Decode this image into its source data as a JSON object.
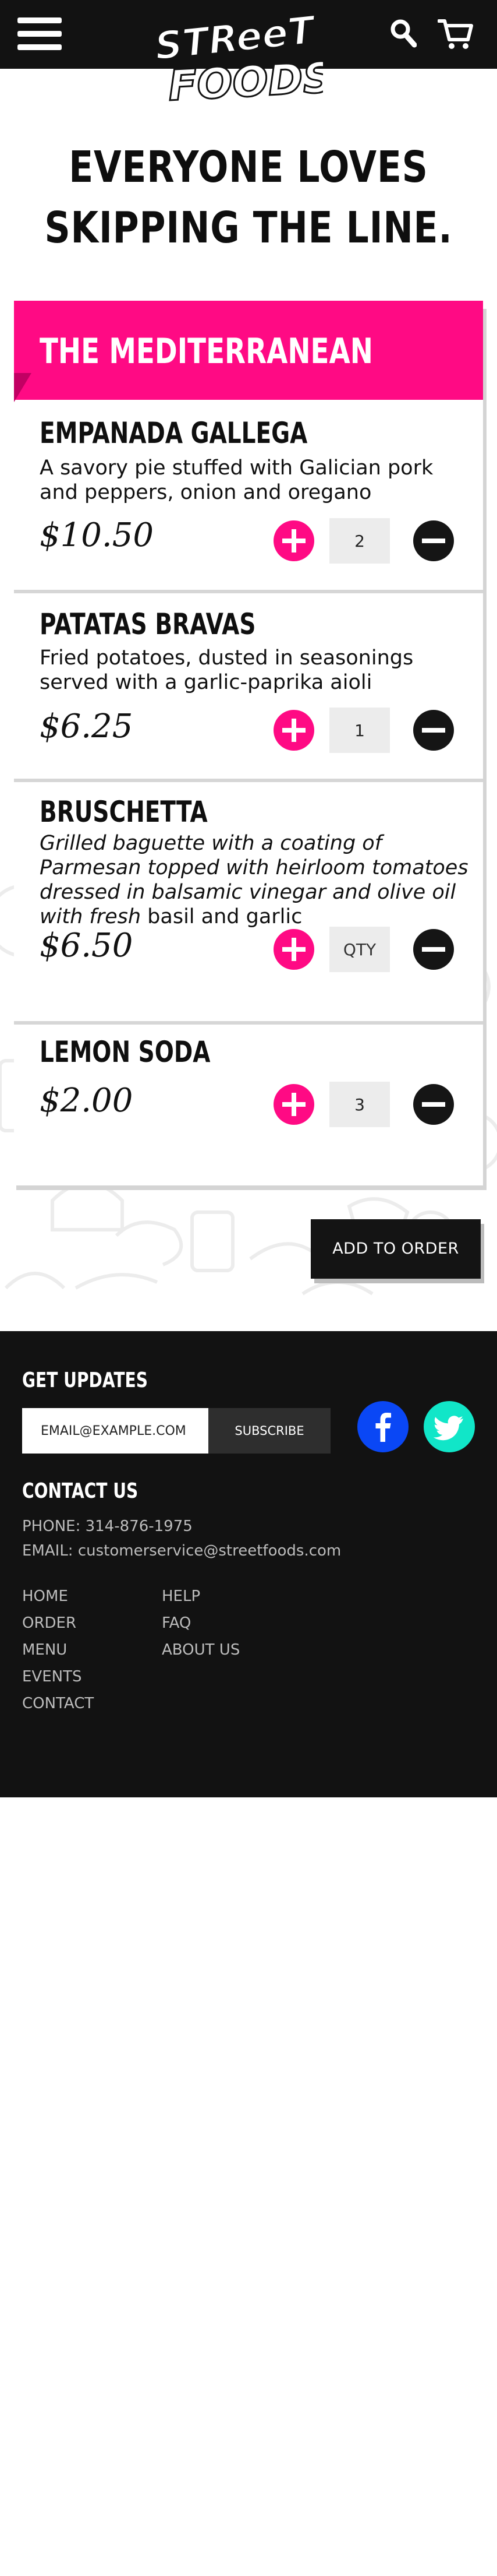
{
  "header": {
    "brand": "Street Foods",
    "hero_line1": "EVERYONE LOVES",
    "hero_line2": "SKIPPING THE LINE.",
    "icons": [
      "menu-icon",
      "search-icon",
      "cart-icon"
    ]
  },
  "menu": {
    "title": "THE MEDITERRANEAN",
    "items": [
      {
        "name": "EMPANADA GALLEGA",
        "description": "A savory pie stuffed with Galician pork and peppers, onion and oregano",
        "price": "$10.50",
        "quantity": "2"
      },
      {
        "name": "PATATAS BRAVAS",
        "description": "Fried potatoes, dusted in seasonings served with a garlic-paprika aioli",
        "price": "$6.25",
        "quantity": "1"
      },
      {
        "name": "BRUSCHETTA",
        "description_italic": "Grilled baguette with a coating of Parmesan topped with heirloom tomatoes dressed in balsamic vinegar and olive oil with fresh",
        "description_plain": " basil and garlic",
        "price": "$6.50",
        "quantity": "",
        "quantity_placeholder": "QTY"
      },
      {
        "name": "LEMON SODA",
        "price": "$2.00",
        "quantity": "3"
      }
    ],
    "add_to_order": "ADD TO ORDER"
  },
  "footer": {
    "updates_title": "GET UPDATES",
    "email_placeholder": "EMAIL@EXAMPLE.COM",
    "subscribe_label": "SUBSCRIBE",
    "contact_title": "CONTACT US",
    "phone": "PHONE: 314-876-1975",
    "email": "EMAIL: customerservice@streetfoods.com",
    "links_col1": [
      "HOME",
      "ORDER",
      "MENU",
      "EVENTS",
      "CONTACT"
    ],
    "links_col2": [
      "HELP",
      "FAQ",
      "ABOUT US"
    ]
  },
  "colors": {
    "accent_pink": "#ff0a84",
    "dark": "#121212",
    "facebook": "#0a47f5",
    "twitter": "#11e6c8"
  }
}
